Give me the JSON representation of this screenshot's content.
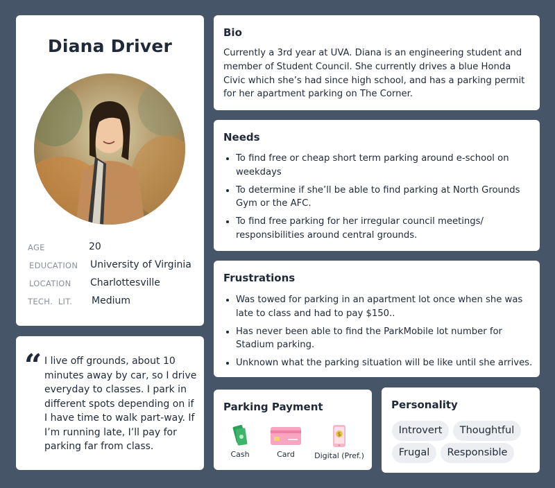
{
  "profile": {
    "name": "Diana Driver",
    "attributes": [
      {
        "label": "AGE",
        "value": "20"
      },
      {
        "label": "EDUCATION",
        "value": "University of Virginia"
      },
      {
        "label": "LOCATION",
        "value": "Charlottesville"
      },
      {
        "label": "TECH.  LIT.",
        "value": "Medium"
      }
    ]
  },
  "quote": {
    "mark": "“",
    "text": "I live off grounds, about 10 minutes away by car, so I drive everyday to classes. I park in different spots depending on if I have time to walk part-way. If I’m running late, I’ll pay for parking far from class."
  },
  "bio": {
    "title": "Bio",
    "text": "Currently a 3rd year at UVA. Diana is an engineering student and member of Student Council. She currently drives a blue Honda Civic which she’s had since high school, and has a parking permit for her apartment parking on The Corner."
  },
  "needs": {
    "title": "Needs",
    "items": [
      "To find free or cheap short term parking around e-school on weekdays",
      "To determine if she’ll be able to find parking at North Grounds Gym or the AFC.",
      "To find free parking for her irregular council meetings/ responsibilities around central grounds."
    ]
  },
  "frustrations": {
    "title": "Frustrations",
    "items": [
      "Was towed  for parking in an apartment lot once when she was late to class and had to pay $150..",
      "Has never been able to find the ParkMobile lot number for Stadium parking.",
      "Unknown what the parking situation will be like until she arrives."
    ]
  },
  "payment": {
    "title": "Parking Payment",
    "items": [
      {
        "label": "Cash",
        "icon": "cash-icon"
      },
      {
        "label": "Card",
        "icon": "credit-card-icon"
      },
      {
        "label": "Digital (Pref.)",
        "icon": "phone-icon"
      }
    ]
  },
  "personality": {
    "title": "Personality",
    "tags": [
      "Introvert",
      "Thoughtful",
      "Frugal",
      "Responsible"
    ]
  },
  "colors": {
    "background": "#475569",
    "card": "#ffffff",
    "tag": "#eceef1",
    "text": "#1f2937",
    "muted": "#8a8f98",
    "card_pink": "#f8a5c2",
    "cash_green": "#2e9e5b"
  }
}
